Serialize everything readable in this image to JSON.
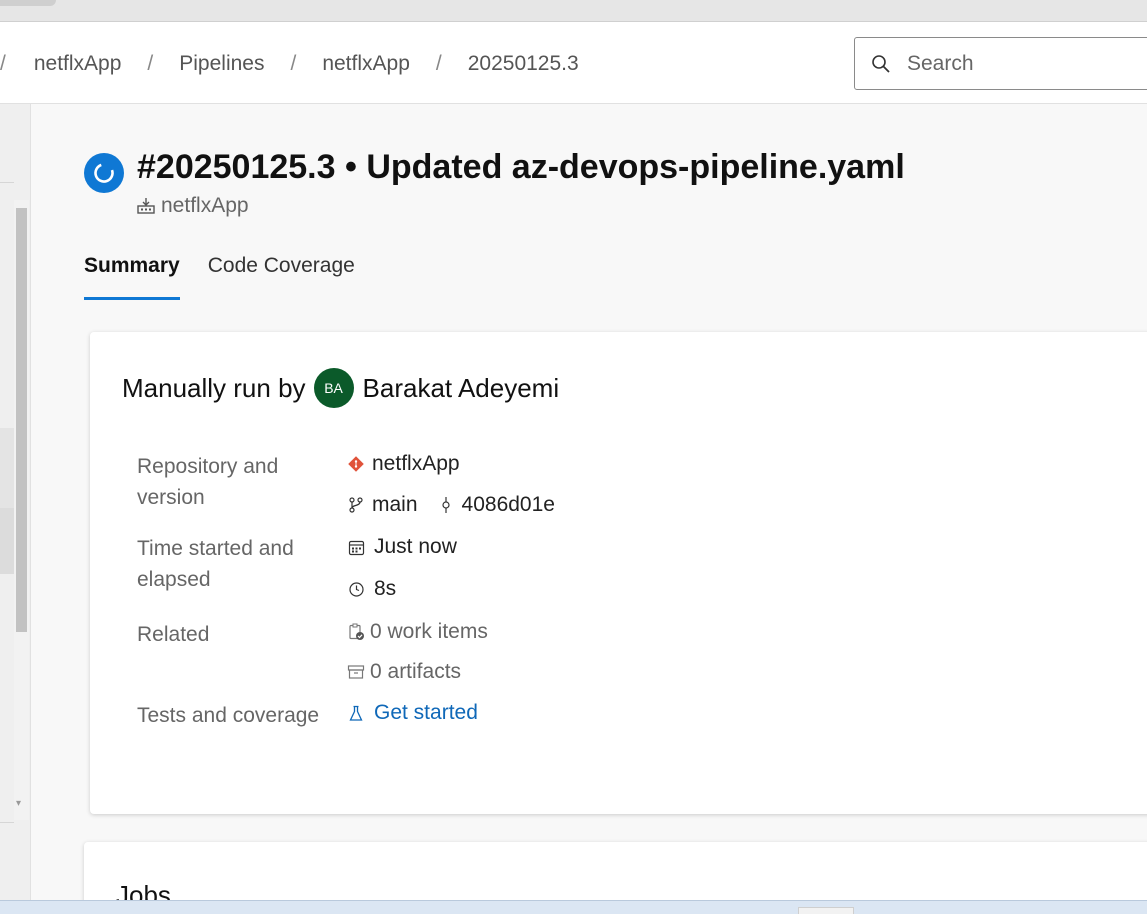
{
  "breadcrumb": {
    "items": [
      "netflxApp",
      "Pipelines",
      "netflxApp",
      "20250125.3"
    ]
  },
  "search": {
    "placeholder": "Search"
  },
  "run": {
    "title": "#20250125.3 • Updated az-devops-pipeline.yaml",
    "pipeline_name": "netflxApp",
    "status_icon": "in-progress-icon"
  },
  "tabs": [
    {
      "label": "Summary",
      "active": true
    },
    {
      "label": "Code Coverage",
      "active": false
    }
  ],
  "summary": {
    "run_by_prefix": "Manually run by",
    "avatar_initials": "BA",
    "user_name": "Barakat Adeyemi",
    "repo_label": "Repository and version",
    "repo_name": "netflxApp",
    "branch": "main",
    "commit": "4086d01e",
    "time_label": "Time started and elapsed",
    "started": "Just now",
    "elapsed": "8s",
    "related_label": "Related",
    "work_items": "0 work items",
    "artifacts": "0 artifacts",
    "tests_label": "Tests and coverage",
    "tests_link": "Get started"
  },
  "jobs": {
    "title": "Jobs"
  },
  "colors": {
    "accent": "#0f78d4",
    "avatar_bg": "#0b5a2a",
    "git_icon": "#e0533a",
    "link": "#0f68b8"
  }
}
